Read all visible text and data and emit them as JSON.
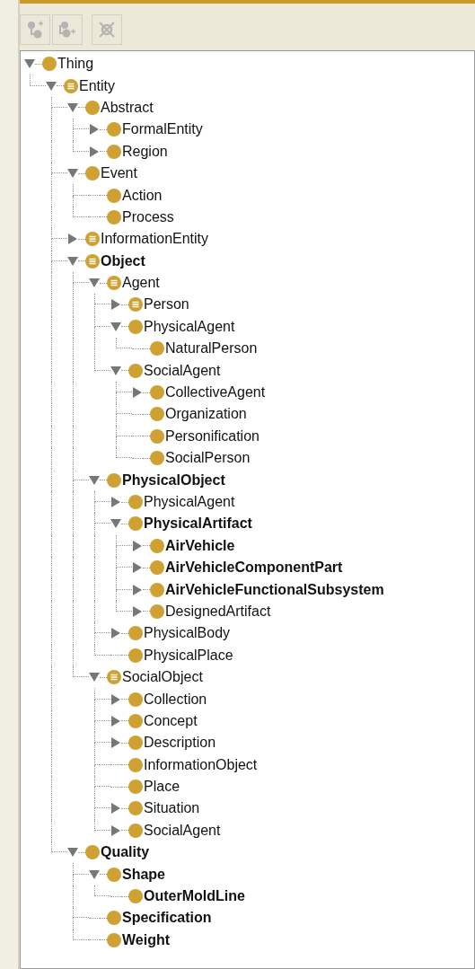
{
  "toolbar": {
    "buttons": [
      {
        "kind": "add-subclass",
        "disabled": true
      },
      {
        "kind": "add-sibling",
        "disabled": true
      },
      {
        "kind": "delete",
        "disabled": true
      }
    ]
  },
  "tree": [
    {
      "label": "Thing",
      "kind": "class",
      "bold": false,
      "expanded": true,
      "children": [
        {
          "label": "Entity",
          "kind": "defined",
          "bold": false,
          "expanded": true,
          "children": [
            {
              "label": "Abstract",
              "kind": "class",
              "bold": false,
              "expanded": true,
              "children": [
                {
                  "label": "FormalEntity",
                  "kind": "class",
                  "bold": false,
                  "expanded": false
                },
                {
                  "label": "Region",
                  "kind": "class",
                  "bold": false,
                  "expanded": false
                }
              ]
            },
            {
              "label": "Event",
              "kind": "class",
              "bold": false,
              "expanded": true,
              "children": [
                {
                  "label": "Action",
                  "kind": "class",
                  "bold": false
                },
                {
                  "label": "Process",
                  "kind": "class",
                  "bold": false
                }
              ]
            },
            {
              "label": "InformationEntity",
              "kind": "defined",
              "bold": false,
              "expanded": false
            },
            {
              "label": "Object",
              "kind": "defined",
              "bold": true,
              "expanded": true,
              "children": [
                {
                  "label": "Agent",
                  "kind": "defined",
                  "bold": false,
                  "expanded": true,
                  "children": [
                    {
                      "label": "Person",
                      "kind": "defined",
                      "bold": false,
                      "expanded": false
                    },
                    {
                      "label": "PhysicalAgent",
                      "kind": "class",
                      "bold": false,
                      "expanded": true,
                      "children": [
                        {
                          "label": "NaturalPerson",
                          "kind": "class",
                          "bold": false
                        }
                      ]
                    },
                    {
                      "label": "SocialAgent",
                      "kind": "class",
                      "bold": false,
                      "expanded": true,
                      "children": [
                        {
                          "label": "CollectiveAgent",
                          "kind": "class",
                          "bold": false,
                          "expanded": false
                        },
                        {
                          "label": "Organization",
                          "kind": "class",
                          "bold": false
                        },
                        {
                          "label": "Personification",
                          "kind": "class",
                          "bold": false
                        },
                        {
                          "label": "SocialPerson",
                          "kind": "class",
                          "bold": false
                        }
                      ]
                    }
                  ]
                },
                {
                  "label": "PhysicalObject",
                  "kind": "class",
                  "bold": true,
                  "expanded": true,
                  "children": [
                    {
                      "label": "PhysicalAgent",
                      "kind": "class",
                      "bold": false,
                      "expanded": false
                    },
                    {
                      "label": "PhysicalArtifact",
                      "kind": "class",
                      "bold": true,
                      "expanded": true,
                      "children": [
                        {
                          "label": "AirVehicle",
                          "kind": "class",
                          "bold": true,
                          "expanded": false
                        },
                        {
                          "label": "AirVehicleComponentPart",
                          "kind": "class",
                          "bold": true,
                          "expanded": false
                        },
                        {
                          "label": "AirVehicleFunctionalSubsystem",
                          "kind": "class",
                          "bold": true,
                          "expanded": false
                        },
                        {
                          "label": "DesignedArtifact",
                          "kind": "class",
                          "bold": false,
                          "expanded": false
                        }
                      ]
                    },
                    {
                      "label": "PhysicalBody",
                      "kind": "class",
                      "bold": false,
                      "expanded": false
                    },
                    {
                      "label": "PhysicalPlace",
                      "kind": "class",
                      "bold": false
                    }
                  ]
                },
                {
                  "label": "SocialObject",
                  "kind": "defined",
                  "bold": false,
                  "expanded": true,
                  "children": [
                    {
                      "label": "Collection",
                      "kind": "class",
                      "bold": false,
                      "expanded": false
                    },
                    {
                      "label": "Concept",
                      "kind": "class",
                      "bold": false,
                      "expanded": false
                    },
                    {
                      "label": "Description",
                      "kind": "class",
                      "bold": false,
                      "expanded": false
                    },
                    {
                      "label": "InformationObject",
                      "kind": "class",
                      "bold": false
                    },
                    {
                      "label": "Place",
                      "kind": "class",
                      "bold": false
                    },
                    {
                      "label": "Situation",
                      "kind": "class",
                      "bold": false,
                      "expanded": false
                    },
                    {
                      "label": "SocialAgent",
                      "kind": "class",
                      "bold": false,
                      "expanded": false
                    }
                  ]
                }
              ]
            },
            {
              "label": "Quality",
              "kind": "class",
              "bold": true,
              "expanded": true,
              "children": [
                {
                  "label": "Shape",
                  "kind": "class",
                  "bold": true,
                  "expanded": true,
                  "children": [
                    {
                      "label": "OuterMoldLine",
                      "kind": "class",
                      "bold": true
                    }
                  ]
                },
                {
                  "label": "Specification",
                  "kind": "class",
                  "bold": true
                },
                {
                  "label": "Weight",
                  "kind": "class",
                  "bold": true
                }
              ]
            }
          ]
        }
      ]
    }
  ]
}
